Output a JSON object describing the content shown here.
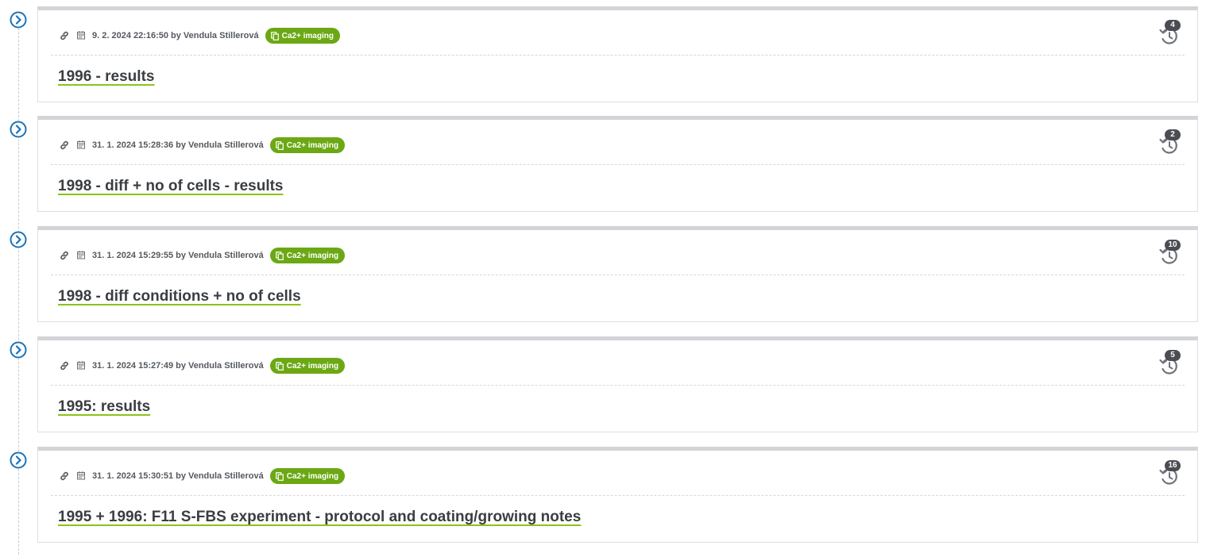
{
  "colors": {
    "accent_blue": "#1a73b8",
    "badge_green": "#6ba814",
    "underline_green": "#8cc21a",
    "card_top_border": "#d2d4d7",
    "history_badge": "#4a4d52"
  },
  "icons": {
    "toggle": "chevron-right-circle-icon",
    "link": "link-icon",
    "date": "calendar-icon",
    "badge": "copy-icon",
    "history": "history-icon"
  },
  "entries": [
    {
      "datetime": "9. 2. 2024 22:16:50",
      "by_label": "by",
      "author": "Vendula Stillerová",
      "tag": "Ca2+ imaging",
      "title": "1996 - results",
      "history_count": "4"
    },
    {
      "datetime": "31. 1. 2024 15:28:36",
      "by_label": "by",
      "author": "Vendula Stillerová",
      "tag": "Ca2+ imaging",
      "title": "1998 - diff + no of cells - results",
      "history_count": "2"
    },
    {
      "datetime": "31. 1. 2024 15:29:55",
      "by_label": "by",
      "author": "Vendula Stillerová",
      "tag": "Ca2+ imaging",
      "title": "1998 - diff conditions + no of cells",
      "history_count": "10"
    },
    {
      "datetime": "31. 1. 2024 15:27:49",
      "by_label": "by",
      "author": "Vendula Stillerová",
      "tag": "Ca2+ imaging",
      "title": "1995: results",
      "history_count": "5"
    },
    {
      "datetime": "31. 1. 2024 15:30:51",
      "by_label": "by",
      "author": "Vendula Stillerová",
      "tag": "Ca2+ imaging",
      "title": "1995 + 1996: F11 S-FBS experiment - protocol and coating/growing notes",
      "history_count": "16"
    }
  ]
}
